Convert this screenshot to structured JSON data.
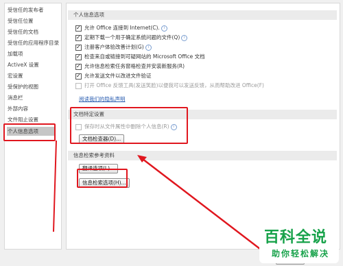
{
  "sidebar": {
    "items": [
      {
        "label": "受信任的发布者"
      },
      {
        "label": "受信任位置"
      },
      {
        "label": "受信任的文档"
      },
      {
        "label": "受信任的应用程序目录"
      },
      {
        "label": "加载项"
      },
      {
        "label": "ActiveX 设置"
      },
      {
        "label": "宏设置"
      },
      {
        "label": "受保护的视图"
      },
      {
        "label": "消息栏"
      },
      {
        "label": "外部内容"
      },
      {
        "label": "文件阻止设置"
      },
      {
        "label": "个人信息选项"
      }
    ],
    "selected_index": 11
  },
  "personal_info": {
    "header": "个人信息选项",
    "options": [
      {
        "label": "允许 Office 连接到 Internet(C).",
        "checked": true,
        "info": true,
        "disabled": false
      },
      {
        "label": "定期下载一个用于确定系统问题的文件(Q)",
        "checked": true,
        "info": true,
        "disabled": false
      },
      {
        "label": "注册客户体验改善计划(G)",
        "checked": true,
        "info": true,
        "disabled": false
      },
      {
        "label": "检查来自或链接到可疑网站的 Microsoft Office 文档",
        "checked": true,
        "info": false,
        "disabled": false
      },
      {
        "label": "允许信息检索任务窗格检查并安装新服务(R)",
        "checked": true,
        "info": false,
        "disabled": false
      },
      {
        "label": "允许发送文件以改进文件验证",
        "checked": true,
        "info": false,
        "disabled": false
      },
      {
        "label": "打开 Office 反馈工具(发送笑脸)以便我可以发送反馈，从而帮助改进 Office(F)",
        "checked": false,
        "info": false,
        "disabled": true
      }
    ],
    "privacy_link": "阅读我们的隐私声明"
  },
  "document_specific": {
    "header": "文档特定设置",
    "option": {
      "label": "保存时从文件属性中删除个人信息(R)",
      "checked": false,
      "info": true,
      "disabled": true
    },
    "inspector_button": "文档检查器(D)..."
  },
  "research": {
    "header": "信息检索参考资料",
    "translation_button": "翻译选项(L)...",
    "research_button": "信息检索选项(H)..."
  },
  "watermark": {
    "main": "百科全说",
    "sub": "助你轻松解决"
  },
  "colors": {
    "highlight_red": "#e0161e",
    "brand_green": "#17a24a",
    "link_blue": "#2a5db0"
  }
}
